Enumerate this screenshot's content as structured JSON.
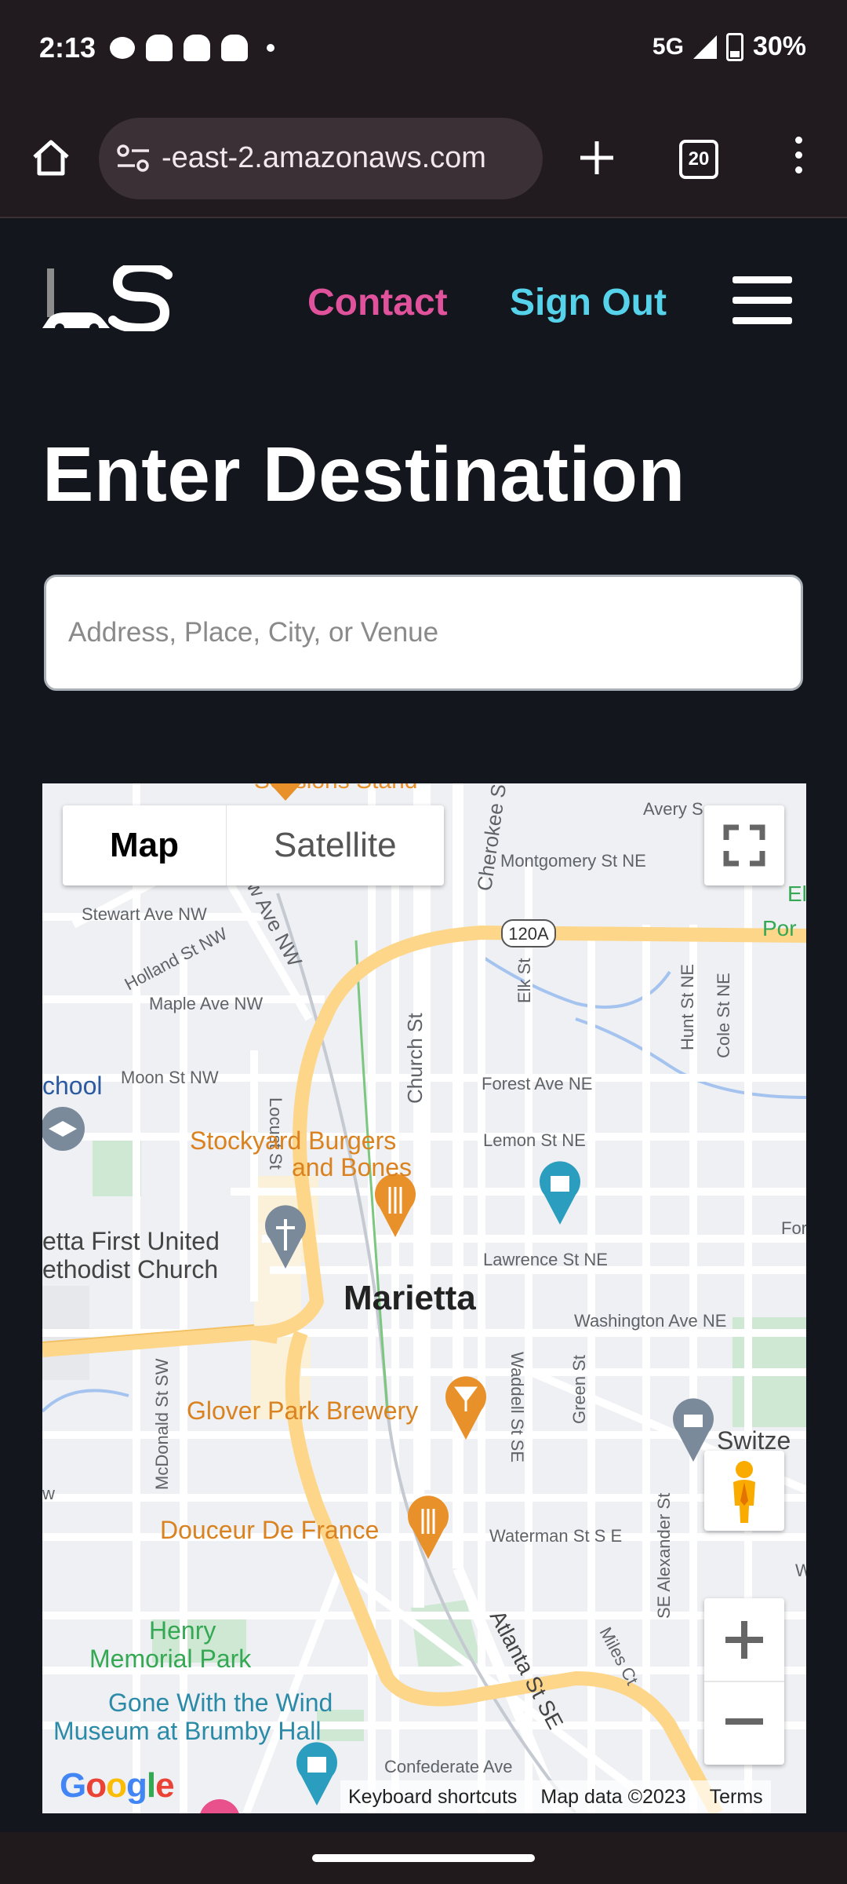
{
  "status_bar": {
    "time": "2:13",
    "network": "5G",
    "battery": "30%",
    "notification_icons": [
      "chat-bubble-icon",
      "snapchat-icon",
      "snapchat-icon",
      "snapchat-icon",
      "dot-icon"
    ]
  },
  "browser": {
    "url": "-east-2.amazonaws.com",
    "tab_count": "20"
  },
  "site": {
    "logo_text": "LS",
    "nav": {
      "contact": "Contact",
      "sign_out": "Sign Out"
    },
    "title": "Enter Destination",
    "search_placeholder": "Address, Place, City, or Venue"
  },
  "map": {
    "type_options": [
      "Map",
      "Satellite"
    ],
    "selected_type": "Map",
    "labels": {
      "sessions": "Sessions Stand",
      "avery": "Avery S",
      "montgomery": "Montgomery St NE",
      "stewart": "Stewart Ave NW",
      "holland": "Holland St NW",
      "ave_nw": "w Ave NW",
      "maple": "Maple Ave NW",
      "cherokee": "Cherokee St",
      "church": "Church St",
      "locust": "Locust St",
      "elk": "Elk St",
      "hunt": "Hunt St NE",
      "cole": "Cole St NE",
      "route": "120A",
      "el": "El",
      "por": "Por",
      "school": "chool",
      "moon": "Moon St NW",
      "forest": "Forest Ave NE",
      "lemon": "Lemon St NE",
      "stockyard1": "Stockyard Burgers",
      "stockyard2": "and Bones",
      "fort": "Fort S",
      "church1": "etta First United",
      "church2": "ethodist Church",
      "lawrence": "Lawrence St NE",
      "city": "Marietta",
      "washington": "Washington Ave NE",
      "mcdonald": "McDonald St SW",
      "waddell": "Waddell St SE",
      "green": "Green St",
      "glover": "Glover Park Brewery",
      "switzer": "Switze",
      "douceur": "Douceur De France",
      "waterman": "Waterman St S E",
      "alexander": "SE Alexander St",
      "wat": "Wat",
      "henry1": "Henry",
      "henry2": "Memorial Park",
      "atlanta": "Atlanta St SE",
      "miles": "Miles Ct",
      "gone1": "Gone With the Wind",
      "gone2": "Museum at Brumby Hall",
      "confederate": "Confederate Ave",
      "w": "w"
    },
    "google_logo": "Google",
    "attribution": {
      "shortcuts": "Keyboard shortcuts",
      "data": "Map data ©2023",
      "terms": "Terms"
    }
  },
  "colors": {
    "page_bg": "#13171d",
    "contact": "#e0529c",
    "sign_out": "#56d3ea",
    "road_major": "#fdd68a",
    "poi_food": "#e8912a",
    "poi_museum": "#2b9dbf",
    "park": "#c3e6cb"
  }
}
